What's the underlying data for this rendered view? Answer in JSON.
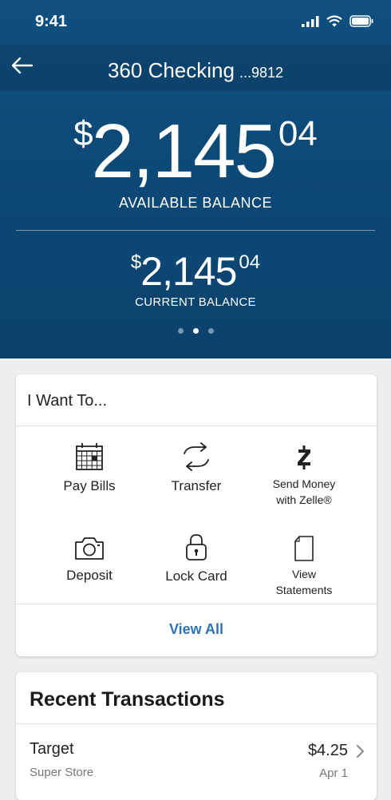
{
  "status": {
    "time": "9:41"
  },
  "header": {
    "title": "360 Checking",
    "account_mask": "...9812"
  },
  "balances": {
    "available": {
      "currency": "$",
      "dollars": "2,145",
      "cents": "04",
      "label": "AVAILABLE BALANCE"
    },
    "current": {
      "currency": "$",
      "dollars": "2,145",
      "cents": "04",
      "label": "CURRENT BALANCE"
    },
    "page_dots": {
      "count": 3,
      "active": 2
    }
  },
  "actions": {
    "title": "I Want To...",
    "items": [
      {
        "label": "Pay Bills",
        "icon": "calendar-icon"
      },
      {
        "label": "Transfer",
        "icon": "transfer-arrows-icon"
      },
      {
        "label": "Send Money\nwith Zelle®",
        "icon": "zelle-icon"
      },
      {
        "label": "Deposit",
        "icon": "camera-icon"
      },
      {
        "label": "Lock Card",
        "icon": "lock-icon"
      },
      {
        "label": "View\nStatements",
        "icon": "document-icon"
      }
    ],
    "view_all": "View All"
  },
  "recent": {
    "title": "Recent Transactions",
    "transactions": [
      {
        "name": "Target",
        "category": "Super Store",
        "amount": "$4.25",
        "date": "Apr 1"
      }
    ]
  },
  "colors": {
    "hero": "#0d4a78",
    "link": "#2e74b5",
    "background": "#eeeeee"
  }
}
